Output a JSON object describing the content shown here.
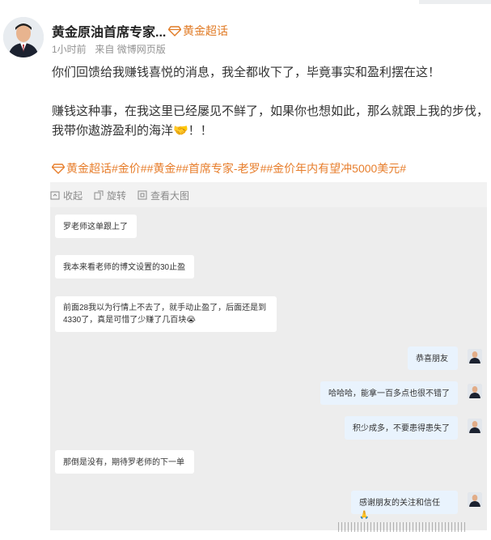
{
  "author": {
    "name": "黄金原油首席专家...",
    "tag": "黄金超话"
  },
  "meta": {
    "time": "1小时前",
    "source": "来自 微博网页版"
  },
  "post": {
    "line1": "你们回馈给我赚钱喜悦的消息，我全都收下了，毕竟事实和盈利摆在这！",
    "line2": "赚钱这种事，在我这里已经屡见不鲜了，如果你也想如此，那么就跟上我的步伐，",
    "line3": "我带你遨游盈利的海洋🤝！！",
    "topics": "黄金超话#金价##黄金##首席专家-老罗##金价年内有望冲5000美元#"
  },
  "media_tools": {
    "collapse": "收起",
    "rotate": "旋转",
    "view_large": "查看大图"
  },
  "chat": {
    "msg1": "罗老师这单跟上了",
    "msg2": "我本来看老师的博文设置的30止盈",
    "msg3a": "前面28我以为行情上不去了，就手动止盈了，后面还是到",
    "msg3b": "4330了，真是可惜了少赚了几百块😭",
    "msg4": "恭喜朋友",
    "msg5": "哈哈哈，能拿一百多点也很不错了",
    "msg6": "积少成多，不要患得患失了",
    "msg7": "那倒是没有，期待罗老师的下一单",
    "msg8": "感谢朋友的关注和信任🙏"
  },
  "colors": {
    "accent_orange": "#e07a24",
    "topic_orange": "#e77e2c",
    "chat_bg": "#ededed",
    "bubble_right": "#e9f3fd"
  }
}
